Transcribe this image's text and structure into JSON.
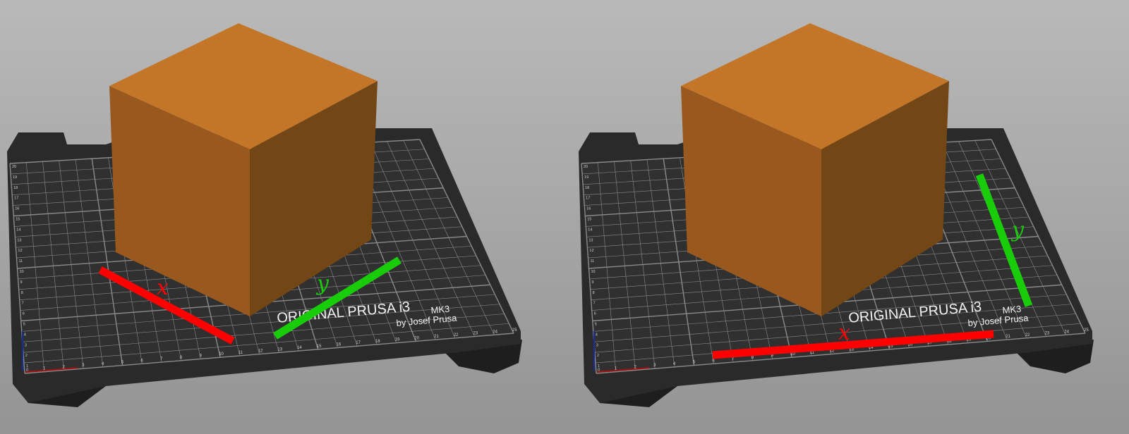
{
  "views": [
    {
      "id": "left-view",
      "bed_logo": {
        "brand": "ORIGINAL PRUSA i3",
        "model": "MK3",
        "maker": "by Josef Prusa"
      },
      "axes": [
        {
          "name": "x-axis",
          "label": "x",
          "color": "#ff0000"
        },
        {
          "name": "y-axis",
          "label": "y",
          "color": "#19cc08"
        }
      ],
      "cube_color": "#c47628"
    },
    {
      "id": "right-view",
      "bed_logo": {
        "brand": "ORIGINAL PRUSA i3",
        "model": "MK3",
        "maker": "by Josef Prusa"
      },
      "axes": [
        {
          "name": "x-axis",
          "label": "x",
          "color": "#ff0000"
        },
        {
          "name": "y-axis",
          "label": "y",
          "color": "#19cc08"
        }
      ],
      "cube_color": "#c47628"
    }
  ],
  "bed": {
    "x_ticks": [
      "1",
      "2",
      "3",
      "4",
      "5",
      "6",
      "7",
      "8",
      "9",
      "10",
      "11",
      "12",
      "13",
      "14",
      "15",
      "16",
      "17",
      "18",
      "19",
      "20",
      "21",
      "22",
      "23",
      "24",
      "25"
    ],
    "y_ticks": [
      "1",
      "2",
      "3",
      "4",
      "5",
      "6",
      "7",
      "8",
      "9",
      "10",
      "11",
      "12",
      "13",
      "14",
      "15",
      "16",
      "17",
      "18",
      "19",
      "20"
    ],
    "origin_label": "0",
    "plate_color": "#2b2b2b",
    "grid_color": "#8a8a8a"
  }
}
